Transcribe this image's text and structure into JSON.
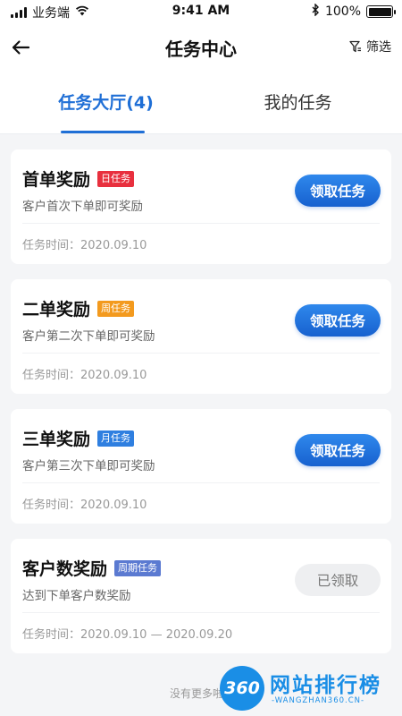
{
  "status_bar": {
    "carrier": "业务端",
    "time": "9:41 AM",
    "battery": "100%"
  },
  "nav": {
    "title": "任务中心",
    "filter_label": "筛选"
  },
  "tabs": [
    {
      "label": "任务大厅(4)",
      "active": true
    },
    {
      "label": "我的任务",
      "active": false
    }
  ],
  "tasks": [
    {
      "title": "首单奖励",
      "badge": "日任务",
      "badge_color": "#e8303e",
      "desc": "客户首次下单即可奖励",
      "time": "任务时间：2020.09.10",
      "button": "领取任务"
    },
    {
      "title": "二单奖励",
      "badge": "周任务",
      "badge_color": "#f39a1e",
      "desc": "客户第二次下单即可奖励",
      "time": "任务时间：2020.09.10",
      "button": "领取任务"
    },
    {
      "title": "三单奖励",
      "badge": "月任务",
      "badge_color": "#2f7fe0",
      "desc": "客户第三次下单即可奖励",
      "time": "任务时间：2020.09.10",
      "button": "领取任务"
    },
    {
      "title": "客户数奖励",
      "badge": "周期任务",
      "badge_color": "#5b7ad1",
      "desc": "达到下单客户数奖励",
      "time": "任务时间：2020.09.10 — 2020.09.20",
      "button": "已领取"
    }
  ],
  "footer": {
    "text": "没有更多啦"
  },
  "watermark": {
    "logo": "360",
    "name": "网站排行榜",
    "url": "-WANGZHAN360.CN-"
  },
  "colors": {
    "accent": "#1f6fd6"
  }
}
